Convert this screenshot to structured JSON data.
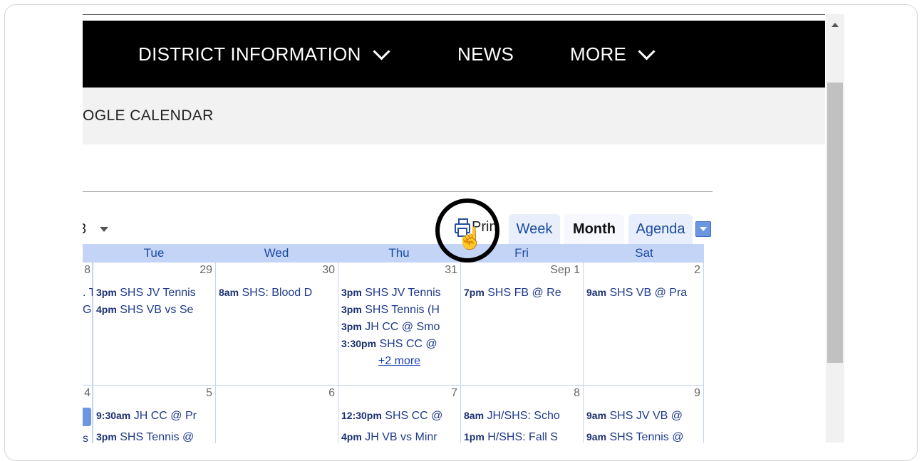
{
  "nav": {
    "items": [
      {
        "label": "DISTRICT INFORMATION",
        "dropdown": true
      },
      {
        "label": "NEWS",
        "dropdown": false
      },
      {
        "label": "MORE",
        "dropdown": true
      }
    ]
  },
  "subbar": {
    "label": "OGLE CALENDAR"
  },
  "calendar": {
    "title_fragment": "3",
    "print_label": "Prin",
    "tabs": [
      {
        "label": "Week",
        "active": false
      },
      {
        "label": "Month",
        "active": true
      },
      {
        "label": "Agenda",
        "active": false
      }
    ],
    "weekdays": [
      "Tue",
      "Wed",
      "Thu",
      "Fri",
      "Sat"
    ],
    "week1": {
      "partial_day": "8",
      "partial_events": [
        ". T",
        "G"
      ],
      "days": [
        {
          "num": "29",
          "events": [
            {
              "time": "3pm",
              "text": "SHS JV Tennis"
            },
            {
              "time": "4pm",
              "text": "SHS VB vs Se"
            }
          ]
        },
        {
          "num": "30",
          "events": [
            {
              "time": "8am",
              "text": "SHS: Blood D"
            }
          ]
        },
        {
          "num": "31",
          "events": [
            {
              "time": "3pm",
              "text": "SHS JV Tennis"
            },
            {
              "time": "3pm",
              "text": "SHS Tennis (H"
            },
            {
              "time": "3pm",
              "text": "JH CC @ Smo"
            },
            {
              "time": "3:30pm",
              "text": "SHS CC @"
            }
          ],
          "more": "+2 more"
        },
        {
          "num": "Sep 1",
          "events": [
            {
              "time": "7pm",
              "text": "SHS FB @ Re"
            }
          ]
        },
        {
          "num": "2",
          "events": [
            {
              "time": "9am",
              "text": "SHS VB @ Pra"
            }
          ]
        }
      ]
    },
    "week2": {
      "partial_day": "4",
      "partial_events": [
        "s"
      ],
      "days": [
        {
          "num": "5",
          "events": [
            {
              "time": "9:30am",
              "text": "JH CC @ Pr"
            },
            {
              "time": "3pm",
              "text": "SHS Tennis @"
            }
          ]
        },
        {
          "num": "6",
          "events": []
        },
        {
          "num": "7",
          "events": [
            {
              "time": "12:30pm",
              "text": "SHS CC @"
            },
            {
              "time": "4pm",
              "text": "JH VB vs Minr"
            }
          ]
        },
        {
          "num": "8",
          "events": [
            {
              "time": "8am",
              "text": "JH/SHS: Scho"
            },
            {
              "time": "1pm",
              "text": "H/SHS: Fall S"
            }
          ]
        },
        {
          "num": "9",
          "events": [
            {
              "time": "9am",
              "text": "SHS JV VB @"
            },
            {
              "time": "9am",
              "text": "SHS Tennis @"
            }
          ]
        }
      ]
    }
  },
  "colors": {
    "nav_bg": "#000000",
    "link_blue": "#1a4aa0",
    "grid": "#c3d4f7"
  }
}
